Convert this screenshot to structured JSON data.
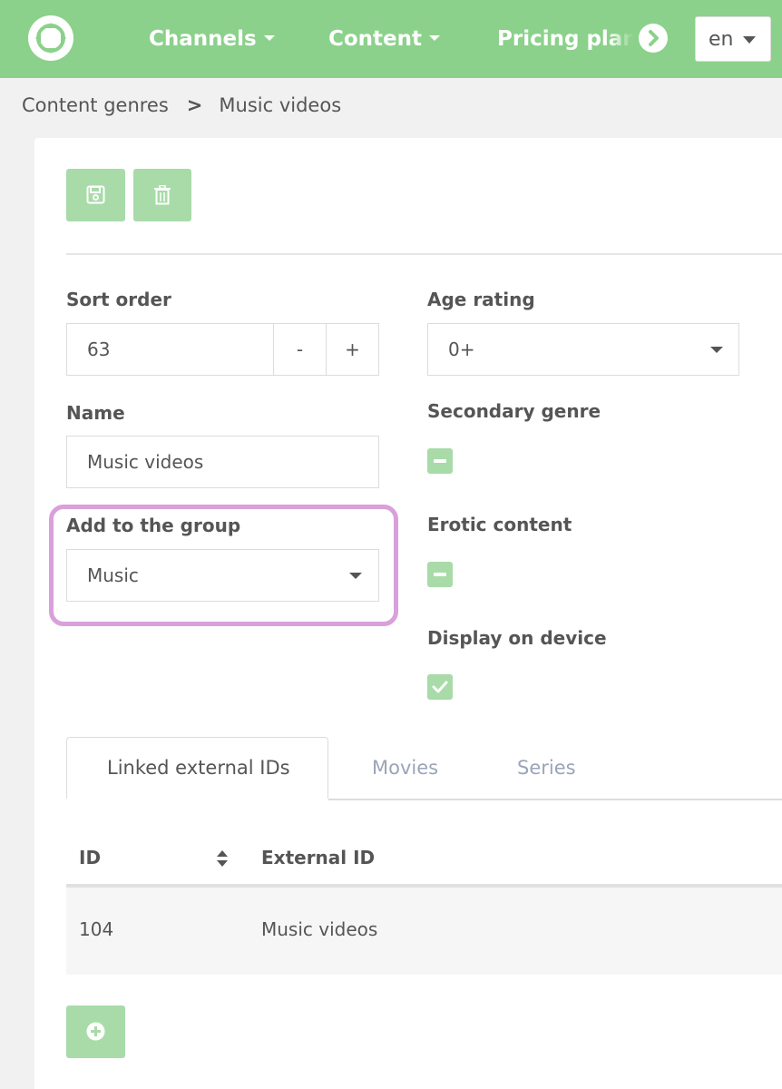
{
  "header": {
    "logo_icon": "app-logo-icon",
    "nav": [
      {
        "label": "Channels"
      },
      {
        "label": "Content"
      },
      {
        "label": "Pricing plans"
      }
    ],
    "next_icon": "chevron-right-circle-icon",
    "language": "en",
    "accent_color": "#8bd18b"
  },
  "breadcrumb": {
    "parent": "Content genres",
    "separator": ">",
    "current": "Music videos"
  },
  "toolbar": {
    "save_icon": "save-icon",
    "delete_icon": "trash-icon",
    "button_color": "#a8dba8"
  },
  "form": {
    "sort_order": {
      "label": "Sort order",
      "value": "63",
      "decrement": "-",
      "increment": "+"
    },
    "age_rating": {
      "label": "Age rating",
      "value": "0+"
    },
    "name": {
      "label": "Name",
      "value": "Music videos"
    },
    "group": {
      "label": "Add to the group",
      "value": "Music"
    },
    "secondary_genre": {
      "label": "Secondary genre",
      "state": "indeterminate"
    },
    "erotic_content": {
      "label": "Erotic content",
      "state": "indeterminate"
    },
    "display_on_device": {
      "label": "Display on device",
      "state": "checked"
    }
  },
  "tabs": [
    {
      "label": "Linked external IDs",
      "active": true
    },
    {
      "label": "Movies",
      "active": false
    },
    {
      "label": "Series",
      "active": false
    }
  ],
  "table": {
    "columns": [
      "ID",
      "External ID"
    ],
    "rows": [
      {
        "id": "104",
        "external_id": "Music videos"
      }
    ]
  },
  "add_button_icon": "plus-circle-icon"
}
